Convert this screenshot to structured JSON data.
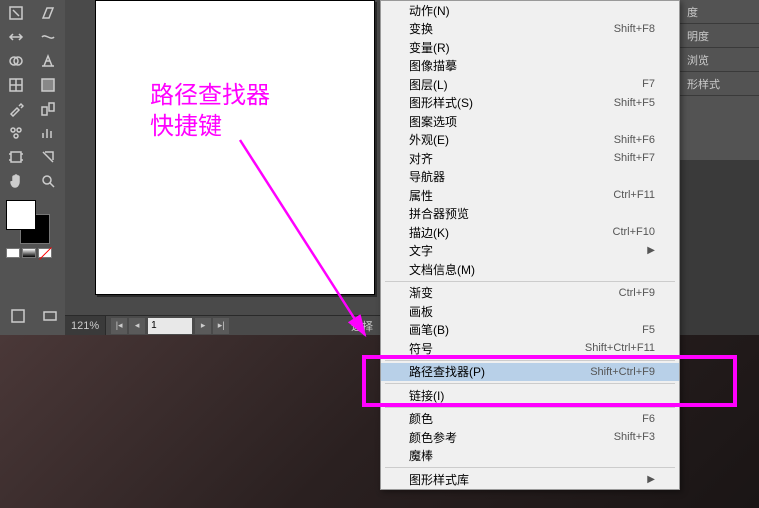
{
  "annotation": {
    "line1": "路径查找器",
    "line2": "快捷键"
  },
  "zoom": "121%",
  "page": "1",
  "status_text": "选择",
  "panels": {
    "p1": "度",
    "p2": "明度",
    "p3": "浏览",
    "p4": "形样式"
  },
  "menu": [
    {
      "label": "动作(N)",
      "sc": "",
      "type": "item"
    },
    {
      "label": "变换",
      "sc": "Shift+F8",
      "type": "item"
    },
    {
      "label": "变量(R)",
      "sc": "",
      "type": "item"
    },
    {
      "label": "图像描摹",
      "sc": "",
      "type": "item"
    },
    {
      "label": "图层(L)",
      "sc": "F7",
      "type": "item"
    },
    {
      "label": "图形样式(S)",
      "sc": "Shift+F5",
      "type": "item"
    },
    {
      "label": "图案选项",
      "sc": "",
      "type": "item"
    },
    {
      "label": "外观(E)",
      "sc": "Shift+F6",
      "type": "item"
    },
    {
      "label": "对齐",
      "sc": "Shift+F7",
      "type": "item"
    },
    {
      "label": "导航器",
      "sc": "",
      "type": "item"
    },
    {
      "label": "属性",
      "sc": "Ctrl+F11",
      "type": "item"
    },
    {
      "label": "拼合器预览",
      "sc": "",
      "type": "item"
    },
    {
      "label": "描边(K)",
      "sc": "Ctrl+F10",
      "type": "item"
    },
    {
      "label": "文字",
      "sc": "",
      "type": "sub"
    },
    {
      "label": "文档信息(M)",
      "sc": "",
      "type": "item"
    },
    {
      "type": "sep"
    },
    {
      "label": "渐变",
      "sc": "Ctrl+F9",
      "type": "item"
    },
    {
      "label": "画板",
      "sc": "",
      "type": "item"
    },
    {
      "label": "画笔(B)",
      "sc": "F5",
      "type": "item"
    },
    {
      "label": "符号",
      "sc": "Shift+Ctrl+F11",
      "type": "item"
    },
    {
      "type": "sep"
    },
    {
      "label": "路径查找器(P)",
      "sc": "Shift+Ctrl+F9",
      "type": "item",
      "sel": true
    },
    {
      "type": "sep"
    },
    {
      "label": "链接(I)",
      "sc": "",
      "type": "item"
    },
    {
      "type": "sep"
    },
    {
      "label": "颜色",
      "sc": "F6",
      "type": "item"
    },
    {
      "label": "颜色参考",
      "sc": "Shift+F3",
      "type": "item"
    },
    {
      "label": "魔棒",
      "sc": "",
      "type": "item"
    },
    {
      "type": "sep"
    },
    {
      "label": "图形样式库",
      "sc": "",
      "type": "sub"
    }
  ]
}
